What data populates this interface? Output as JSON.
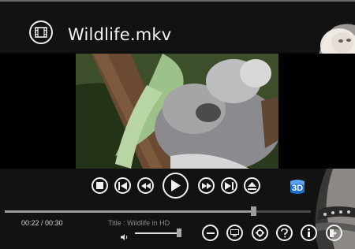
{
  "file": {
    "title": "Wildlife.mkv",
    "icon": "film-icon"
  },
  "playback": {
    "time": "00:22 / 00:30",
    "media_title": "Title : Wildlife in HD",
    "progress": 0.82,
    "volume": 1.0
  },
  "buttons": {
    "stop": "stop-icon",
    "prev": "skip-previous-icon",
    "rewind": "rewind-icon",
    "play": "play-icon",
    "forward": "fast-forward-icon",
    "next": "skip-next-icon",
    "eject": "eject-icon",
    "three_d": "3D",
    "minimize": "minimize-icon",
    "display": "display-icon",
    "settings": "gear-icon",
    "help": "help-icon",
    "info": "info-icon",
    "exit": "exit-icon"
  },
  "colors": {
    "background": "#121212",
    "badge": "#1e6fd0",
    "icons": "#f0f0f0"
  }
}
